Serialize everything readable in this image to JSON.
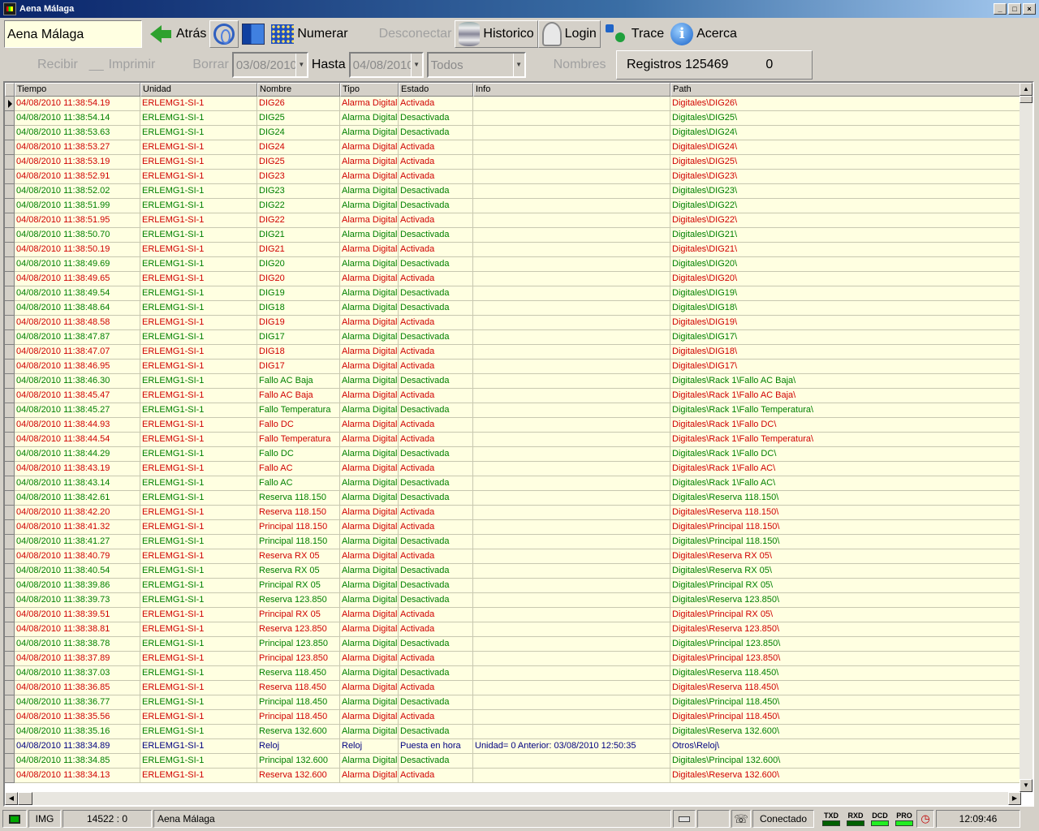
{
  "window": {
    "title": "Aena Málaga",
    "buttons": [
      "_",
      "□",
      "×"
    ]
  },
  "toolbar": {
    "site": "Aena Málaga",
    "back": "Atrás",
    "number": "Numerar",
    "disconnect": "Desconectar",
    "history": "Historico",
    "login": "Login",
    "trace": "Trace",
    "about": "Acerca"
  },
  "filter": {
    "receive": "Recibir",
    "print": "Imprimir",
    "delete": "Borrar",
    "from_date": "03/08/2010",
    "to_label": "Hasta",
    "to_date": "04/08/2010",
    "type_select": "Todos",
    "names": "Nombres",
    "records_label": "Registros 125469",
    "records_extra": "0"
  },
  "colors": {
    "active": "#d00000",
    "inactive": "#008000",
    "clock": "#000080",
    "row_bg": "#ffffe1"
  },
  "grid": {
    "columns": [
      "Tiempo",
      "Unidad",
      "Nombre",
      "Tipo",
      "Estado",
      "Info",
      "Path"
    ],
    "rows": [
      {
        "t": "04/08/2010 11:38:54.19",
        "u": "ERLEMG1-SI-1",
        "n": "DIG26",
        "ty": "Alarma Digital",
        "s": "Activada",
        "i": "",
        "p": "Digitales\\DIG26\\"
      },
      {
        "t": "04/08/2010 11:38:54.14",
        "u": "ERLEMG1-SI-1",
        "n": "DIG25",
        "ty": "Alarma Digital",
        "s": "Desactivada",
        "i": "",
        "p": "Digitales\\DIG25\\"
      },
      {
        "t": "04/08/2010 11:38:53.63",
        "u": "ERLEMG1-SI-1",
        "n": "DIG24",
        "ty": "Alarma Digital",
        "s": "Desactivada",
        "i": "",
        "p": "Digitales\\DIG24\\"
      },
      {
        "t": "04/08/2010 11:38:53.27",
        "u": "ERLEMG1-SI-1",
        "n": "DIG24",
        "ty": "Alarma Digital",
        "s": "Activada",
        "i": "",
        "p": "Digitales\\DIG24\\"
      },
      {
        "t": "04/08/2010 11:38:53.19",
        "u": "ERLEMG1-SI-1",
        "n": "DIG25",
        "ty": "Alarma Digital",
        "s": "Activada",
        "i": "",
        "p": "Digitales\\DIG25\\"
      },
      {
        "t": "04/08/2010 11:38:52.91",
        "u": "ERLEMG1-SI-1",
        "n": "DIG23",
        "ty": "Alarma Digital",
        "s": "Activada",
        "i": "",
        "p": "Digitales\\DIG23\\"
      },
      {
        "t": "04/08/2010 11:38:52.02",
        "u": "ERLEMG1-SI-1",
        "n": "DIG23",
        "ty": "Alarma Digital",
        "s": "Desactivada",
        "i": "",
        "p": "Digitales\\DIG23\\"
      },
      {
        "t": "04/08/2010 11:38:51.99",
        "u": "ERLEMG1-SI-1",
        "n": "DIG22",
        "ty": "Alarma Digital",
        "s": "Desactivada",
        "i": "",
        "p": "Digitales\\DIG22\\"
      },
      {
        "t": "04/08/2010 11:38:51.95",
        "u": "ERLEMG1-SI-1",
        "n": "DIG22",
        "ty": "Alarma Digital",
        "s": "Activada",
        "i": "",
        "p": "Digitales\\DIG22\\"
      },
      {
        "t": "04/08/2010 11:38:50.70",
        "u": "ERLEMG1-SI-1",
        "n": "DIG21",
        "ty": "Alarma Digital",
        "s": "Desactivada",
        "i": "",
        "p": "Digitales\\DIG21\\"
      },
      {
        "t": "04/08/2010 11:38:50.19",
        "u": "ERLEMG1-SI-1",
        "n": "DIG21",
        "ty": "Alarma Digital",
        "s": "Activada",
        "i": "",
        "p": "Digitales\\DIG21\\"
      },
      {
        "t": "04/08/2010 11:38:49.69",
        "u": "ERLEMG1-SI-1",
        "n": "DIG20",
        "ty": "Alarma Digital",
        "s": "Desactivada",
        "i": "",
        "p": "Digitales\\DIG20\\"
      },
      {
        "t": "04/08/2010 11:38:49.65",
        "u": "ERLEMG1-SI-1",
        "n": "DIG20",
        "ty": "Alarma Digital",
        "s": "Activada",
        "i": "",
        "p": "Digitales\\DIG20\\"
      },
      {
        "t": "04/08/2010 11:38:49.54",
        "u": "ERLEMG1-SI-1",
        "n": "DIG19",
        "ty": "Alarma Digital",
        "s": "Desactivada",
        "i": "",
        "p": "Digitales\\DIG19\\"
      },
      {
        "t": "04/08/2010 11:38:48.64",
        "u": "ERLEMG1-SI-1",
        "n": "DIG18",
        "ty": "Alarma Digital",
        "s": "Desactivada",
        "i": "",
        "p": "Digitales\\DIG18\\"
      },
      {
        "t": "04/08/2010 11:38:48.58",
        "u": "ERLEMG1-SI-1",
        "n": "DIG19",
        "ty": "Alarma Digital",
        "s": "Activada",
        "i": "",
        "p": "Digitales\\DIG19\\"
      },
      {
        "t": "04/08/2010 11:38:47.87",
        "u": "ERLEMG1-SI-1",
        "n": "DIG17",
        "ty": "Alarma Digital",
        "s": "Desactivada",
        "i": "",
        "p": "Digitales\\DIG17\\"
      },
      {
        "t": "04/08/2010 11:38:47.07",
        "u": "ERLEMG1-SI-1",
        "n": "DIG18",
        "ty": "Alarma Digital",
        "s": "Activada",
        "i": "",
        "p": "Digitales\\DIG18\\"
      },
      {
        "t": "04/08/2010 11:38:46.95",
        "u": "ERLEMG1-SI-1",
        "n": "DIG17",
        "ty": "Alarma Digital",
        "s": "Activada",
        "i": "",
        "p": "Digitales\\DIG17\\"
      },
      {
        "t": "04/08/2010 11:38:46.30",
        "u": "ERLEMG1-SI-1",
        "n": "Fallo AC Baja",
        "ty": "Alarma Digital",
        "s": "Desactivada",
        "i": "",
        "p": "Digitales\\Rack 1\\Fallo AC Baja\\"
      },
      {
        "t": "04/08/2010 11:38:45.47",
        "u": "ERLEMG1-SI-1",
        "n": "Fallo AC Baja",
        "ty": "Alarma Digital",
        "s": "Activada",
        "i": "",
        "p": "Digitales\\Rack 1\\Fallo AC Baja\\"
      },
      {
        "t": "04/08/2010 11:38:45.27",
        "u": "ERLEMG1-SI-1",
        "n": "Fallo Temperatura",
        "ty": "Alarma Digital",
        "s": "Desactivada",
        "i": "",
        "p": "Digitales\\Rack 1\\Fallo Temperatura\\"
      },
      {
        "t": "04/08/2010 11:38:44.93",
        "u": "ERLEMG1-SI-1",
        "n": "Fallo DC",
        "ty": "Alarma Digital",
        "s": "Activada",
        "i": "",
        "p": "Digitales\\Rack 1\\Fallo DC\\"
      },
      {
        "t": "04/08/2010 11:38:44.54",
        "u": "ERLEMG1-SI-1",
        "n": "Fallo Temperatura",
        "ty": "Alarma Digital",
        "s": "Activada",
        "i": "",
        "p": "Digitales\\Rack 1\\Fallo Temperatura\\"
      },
      {
        "t": "04/08/2010 11:38:44.29",
        "u": "ERLEMG1-SI-1",
        "n": "Fallo DC",
        "ty": "Alarma Digital",
        "s": "Desactivada",
        "i": "",
        "p": "Digitales\\Rack 1\\Fallo DC\\"
      },
      {
        "t": "04/08/2010 11:38:43.19",
        "u": "ERLEMG1-SI-1",
        "n": "Fallo AC",
        "ty": "Alarma Digital",
        "s": "Activada",
        "i": "",
        "p": "Digitales\\Rack 1\\Fallo AC\\"
      },
      {
        "t": "04/08/2010 11:38:43.14",
        "u": "ERLEMG1-SI-1",
        "n": "Fallo AC",
        "ty": "Alarma Digital",
        "s": "Desactivada",
        "i": "",
        "p": "Digitales\\Rack 1\\Fallo AC\\"
      },
      {
        "t": "04/08/2010 11:38:42.61",
        "u": "ERLEMG1-SI-1",
        "n": "Reserva 118.150",
        "ty": "Alarma Digital",
        "s": "Desactivada",
        "i": "",
        "p": "Digitales\\Reserva 118.150\\"
      },
      {
        "t": "04/08/2010 11:38:42.20",
        "u": "ERLEMG1-SI-1",
        "n": "Reserva 118.150",
        "ty": "Alarma Digital",
        "s": "Activada",
        "i": "",
        "p": "Digitales\\Reserva 118.150\\"
      },
      {
        "t": "04/08/2010 11:38:41.32",
        "u": "ERLEMG1-SI-1",
        "n": "Principal 118.150",
        "ty": "Alarma Digital",
        "s": "Activada",
        "i": "",
        "p": "Digitales\\Principal 118.150\\"
      },
      {
        "t": "04/08/2010 11:38:41.27",
        "u": "ERLEMG1-SI-1",
        "n": "Principal 118.150",
        "ty": "Alarma Digital",
        "s": "Desactivada",
        "i": "",
        "p": "Digitales\\Principal 118.150\\"
      },
      {
        "t": "04/08/2010 11:38:40.79",
        "u": "ERLEMG1-SI-1",
        "n": "Reserva RX 05",
        "ty": "Alarma Digital",
        "s": "Activada",
        "i": "",
        "p": "Digitales\\Reserva RX 05\\"
      },
      {
        "t": "04/08/2010 11:38:40.54",
        "u": "ERLEMG1-SI-1",
        "n": "Reserva RX 05",
        "ty": "Alarma Digital",
        "s": "Desactivada",
        "i": "",
        "p": "Digitales\\Reserva RX 05\\"
      },
      {
        "t": "04/08/2010 11:38:39.86",
        "u": "ERLEMG1-SI-1",
        "n": "Principal RX 05",
        "ty": "Alarma Digital",
        "s": "Desactivada",
        "i": "",
        "p": "Digitales\\Principal RX 05\\"
      },
      {
        "t": "04/08/2010 11:38:39.73",
        "u": "ERLEMG1-SI-1",
        "n": "Reserva 123.850",
        "ty": "Alarma Digital",
        "s": "Desactivada",
        "i": "",
        "p": "Digitales\\Reserva 123.850\\"
      },
      {
        "t": "04/08/2010 11:38:39.51",
        "u": "ERLEMG1-SI-1",
        "n": "Principal RX 05",
        "ty": "Alarma Digital",
        "s": "Activada",
        "i": "",
        "p": "Digitales\\Principal RX 05\\"
      },
      {
        "t": "04/08/2010 11:38:38.81",
        "u": "ERLEMG1-SI-1",
        "n": "Reserva 123.850",
        "ty": "Alarma Digital",
        "s": "Activada",
        "i": "",
        "p": "Digitales\\Reserva 123.850\\"
      },
      {
        "t": "04/08/2010 11:38:38.78",
        "u": "ERLEMG1-SI-1",
        "n": "Principal 123.850",
        "ty": "Alarma Digital",
        "s": "Desactivada",
        "i": "",
        "p": "Digitales\\Principal 123.850\\"
      },
      {
        "t": "04/08/2010 11:38:37.89",
        "u": "ERLEMG1-SI-1",
        "n": "Principal 123.850",
        "ty": "Alarma Digital",
        "s": "Activada",
        "i": "",
        "p": "Digitales\\Principal 123.850\\"
      },
      {
        "t": "04/08/2010 11:38:37.03",
        "u": "ERLEMG1-SI-1",
        "n": "Reserva 118.450",
        "ty": "Alarma Digital",
        "s": "Desactivada",
        "i": "",
        "p": "Digitales\\Reserva 118.450\\"
      },
      {
        "t": "04/08/2010 11:38:36.85",
        "u": "ERLEMG1-SI-1",
        "n": "Reserva 118.450",
        "ty": "Alarma Digital",
        "s": "Activada",
        "i": "",
        "p": "Digitales\\Reserva 118.450\\"
      },
      {
        "t": "04/08/2010 11:38:36.77",
        "u": "ERLEMG1-SI-1",
        "n": "Principal 118.450",
        "ty": "Alarma Digital",
        "s": "Desactivada",
        "i": "",
        "p": "Digitales\\Principal 118.450\\"
      },
      {
        "t": "04/08/2010 11:38:35.56",
        "u": "ERLEMG1-SI-1",
        "n": "Principal 118.450",
        "ty": "Alarma Digital",
        "s": "Activada",
        "i": "",
        "p": "Digitales\\Principal 118.450\\"
      },
      {
        "t": "04/08/2010 11:38:35.16",
        "u": "ERLEMG1-SI-1",
        "n": "Reserva 132.600",
        "ty": "Alarma Digital",
        "s": "Desactivada",
        "i": "",
        "p": "Digitales\\Reserva 132.600\\"
      },
      {
        "t": "04/08/2010 11:38:34.89",
        "u": "ERLEMG1-SI-1",
        "n": "Reloj",
        "ty": "Reloj",
        "s": "Puesta en hora",
        "i": "Unidad= 0 Anterior: 03/08/2010 12:50:35",
        "p": "Otros\\Reloj\\"
      },
      {
        "t": "04/08/2010 11:38:34.85",
        "u": "ERLEMG1-SI-1",
        "n": "Principal 132.600",
        "ty": "Alarma Digital",
        "s": "Desactivada",
        "i": "",
        "p": "Digitales\\Principal 132.600\\"
      },
      {
        "t": "04/08/2010 11:38:34.13",
        "u": "ERLEMG1-SI-1",
        "n": "Reserva 132.600",
        "ty": "Alarma Digital",
        "s": "Activada",
        "i": "",
        "p": "Digitales\\Reserva 132.600\\"
      }
    ]
  },
  "status": {
    "img": "IMG",
    "counter": "14522 : 0",
    "site": "Aena Málaga",
    "connection": "Conectado",
    "leds": [
      {
        "label": "TXD",
        "color": "#006000"
      },
      {
        "label": "RXD",
        "color": "#006000"
      },
      {
        "label": "DCD",
        "color": "#22ee22"
      },
      {
        "label": "PRO",
        "color": "#22ee22"
      }
    ],
    "time": "12:09:46"
  }
}
